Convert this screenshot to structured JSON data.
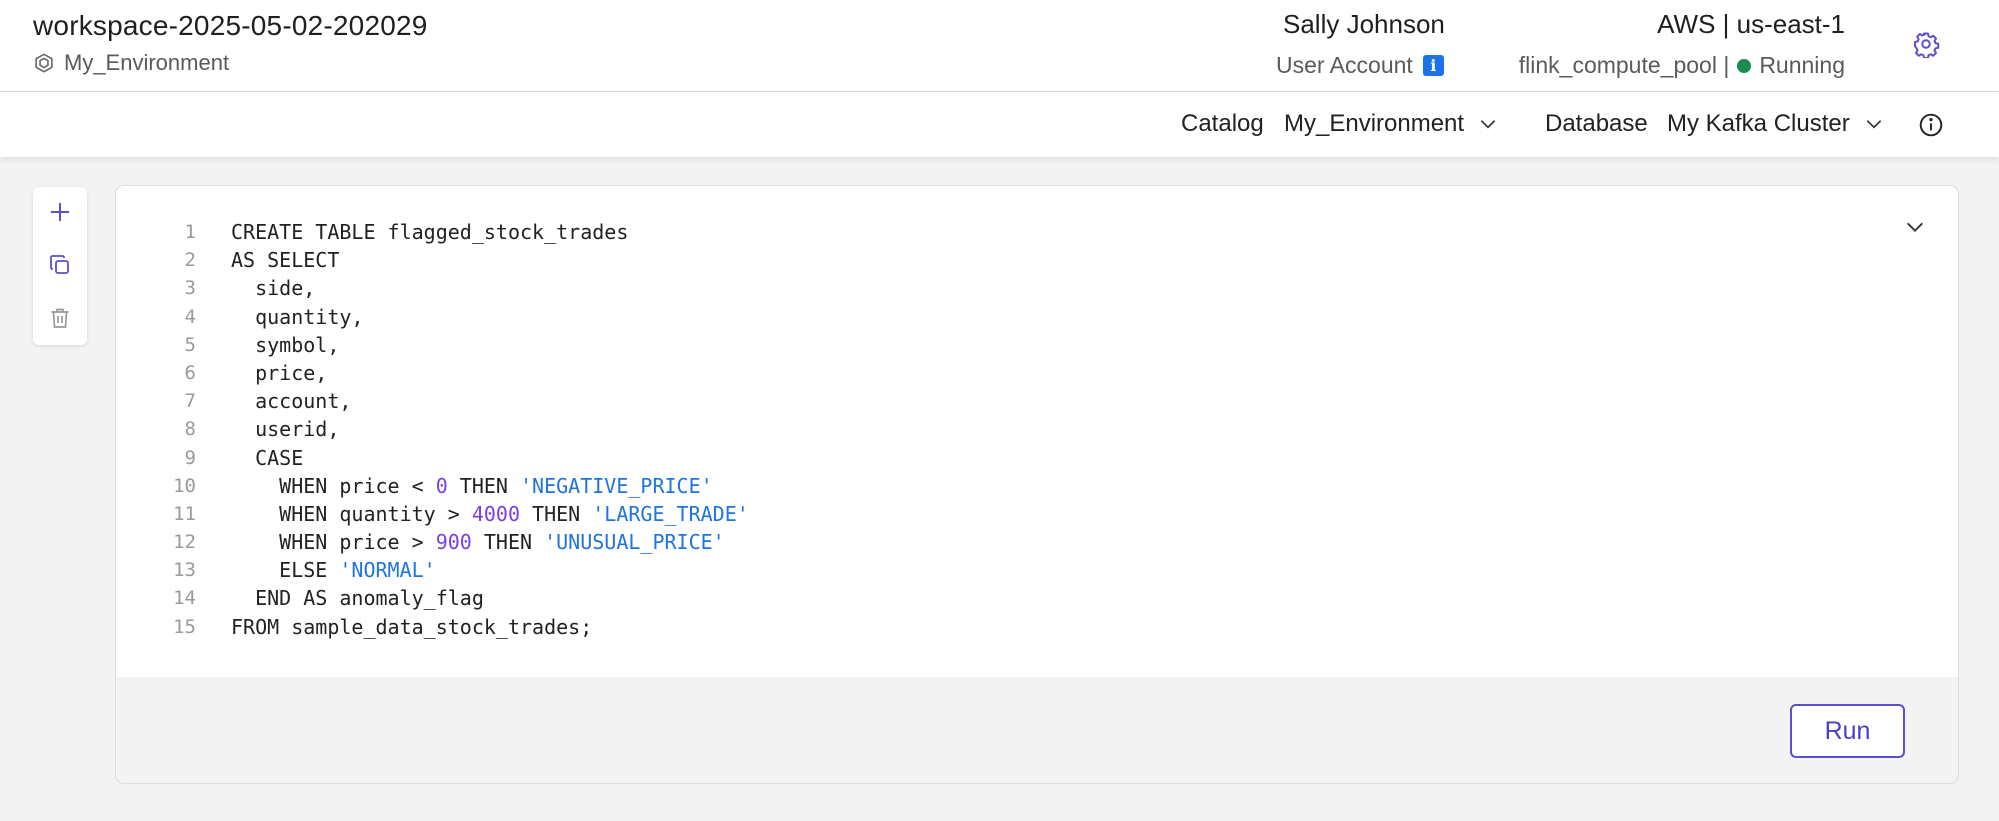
{
  "header": {
    "workspace_title": "workspace-2025-05-02-202029",
    "environment": "My_Environment",
    "user_name": "Sally Johnson",
    "user_account": "User Account",
    "info_badge": "i",
    "region": "AWS | us-east-1",
    "compute_pool": "flink_compute_pool |",
    "pool_status": "Running",
    "status_color": "#1a8c4e"
  },
  "toolbar": {
    "catalog_label": "Catalog",
    "catalog_value": "My_Environment",
    "database_label": "Database",
    "database_value": "My Kafka Cluster"
  },
  "side_actions": [
    "plus-icon",
    "copy-icon",
    "trash-icon"
  ],
  "editor": {
    "lines": [
      {
        "n": "1",
        "tokens": [
          {
            "t": "CREATE TABLE flagged_stock_trades",
            "k": "plain"
          }
        ]
      },
      {
        "n": "2",
        "tokens": [
          {
            "t": "AS SELECT",
            "k": "plain"
          }
        ]
      },
      {
        "n": "3",
        "tokens": [
          {
            "t": "  side,",
            "k": "plain"
          }
        ]
      },
      {
        "n": "4",
        "tokens": [
          {
            "t": "  quantity,",
            "k": "plain"
          }
        ]
      },
      {
        "n": "5",
        "tokens": [
          {
            "t": "  symbol,",
            "k": "plain"
          }
        ]
      },
      {
        "n": "6",
        "tokens": [
          {
            "t": "  price,",
            "k": "plain"
          }
        ]
      },
      {
        "n": "7",
        "tokens": [
          {
            "t": "  account,",
            "k": "plain"
          }
        ]
      },
      {
        "n": "8",
        "tokens": [
          {
            "t": "  userid,",
            "k": "plain"
          }
        ]
      },
      {
        "n": "9",
        "tokens": [
          {
            "t": "  CASE",
            "k": "plain"
          }
        ]
      },
      {
        "n": "10",
        "tokens": [
          {
            "t": "    WHEN price < ",
            "k": "plain"
          },
          {
            "t": "0",
            "k": "num"
          },
          {
            "t": " THEN ",
            "k": "plain"
          },
          {
            "t": "'NEGATIVE_PRICE'",
            "k": "str"
          }
        ]
      },
      {
        "n": "11",
        "tokens": [
          {
            "t": "    WHEN quantity > ",
            "k": "plain"
          },
          {
            "t": "4000",
            "k": "num"
          },
          {
            "t": " THEN ",
            "k": "plain"
          },
          {
            "t": "'LARGE_TRADE'",
            "k": "str"
          }
        ]
      },
      {
        "n": "12",
        "tokens": [
          {
            "t": "    WHEN price > ",
            "k": "plain"
          },
          {
            "t": "900",
            "k": "num"
          },
          {
            "t": " THEN ",
            "k": "plain"
          },
          {
            "t": "'UNUSUAL_PRICE'",
            "k": "str"
          }
        ]
      },
      {
        "n": "13",
        "tokens": [
          {
            "t": "    ELSE ",
            "k": "plain"
          },
          {
            "t": "'NORMAL'",
            "k": "str"
          }
        ]
      },
      {
        "n": "14",
        "tokens": [
          {
            "t": "  END AS anomaly_flag",
            "k": "plain"
          }
        ]
      },
      {
        "n": "15",
        "tokens": [
          {
            "t": "FROM sample_data_stock_trades;",
            "k": "plain"
          }
        ]
      }
    ],
    "colors": {
      "number": "#7b3fe4",
      "string": "#1f74e0",
      "accent": "#5a4fcf"
    }
  },
  "run_label": "Run"
}
